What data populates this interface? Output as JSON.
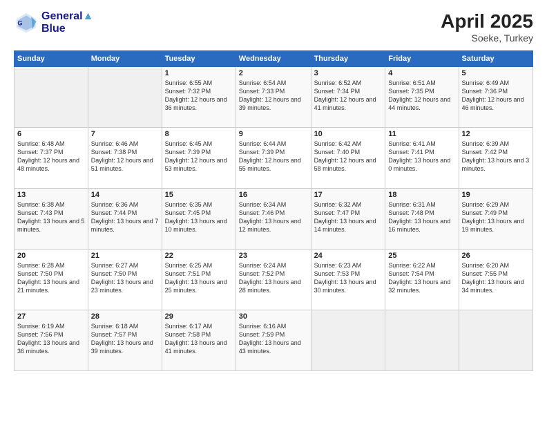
{
  "header": {
    "logo_line1": "General",
    "logo_line2": "Blue",
    "month": "April 2025",
    "location": "Soeke, Turkey"
  },
  "days_of_week": [
    "Sunday",
    "Monday",
    "Tuesday",
    "Wednesday",
    "Thursday",
    "Friday",
    "Saturday"
  ],
  "weeks": [
    [
      {
        "day": "",
        "info": ""
      },
      {
        "day": "",
        "info": ""
      },
      {
        "day": "1",
        "info": "Sunrise: 6:55 AM\nSunset: 7:32 PM\nDaylight: 12 hours and 36 minutes."
      },
      {
        "day": "2",
        "info": "Sunrise: 6:54 AM\nSunset: 7:33 PM\nDaylight: 12 hours and 39 minutes."
      },
      {
        "day": "3",
        "info": "Sunrise: 6:52 AM\nSunset: 7:34 PM\nDaylight: 12 hours and 41 minutes."
      },
      {
        "day": "4",
        "info": "Sunrise: 6:51 AM\nSunset: 7:35 PM\nDaylight: 12 hours and 44 minutes."
      },
      {
        "day": "5",
        "info": "Sunrise: 6:49 AM\nSunset: 7:36 PM\nDaylight: 12 hours and 46 minutes."
      }
    ],
    [
      {
        "day": "6",
        "info": "Sunrise: 6:48 AM\nSunset: 7:37 PM\nDaylight: 12 hours and 48 minutes."
      },
      {
        "day": "7",
        "info": "Sunrise: 6:46 AM\nSunset: 7:38 PM\nDaylight: 12 hours and 51 minutes."
      },
      {
        "day": "8",
        "info": "Sunrise: 6:45 AM\nSunset: 7:39 PM\nDaylight: 12 hours and 53 minutes."
      },
      {
        "day": "9",
        "info": "Sunrise: 6:44 AM\nSunset: 7:39 PM\nDaylight: 12 hours and 55 minutes."
      },
      {
        "day": "10",
        "info": "Sunrise: 6:42 AM\nSunset: 7:40 PM\nDaylight: 12 hours and 58 minutes."
      },
      {
        "day": "11",
        "info": "Sunrise: 6:41 AM\nSunset: 7:41 PM\nDaylight: 13 hours and 0 minutes."
      },
      {
        "day": "12",
        "info": "Sunrise: 6:39 AM\nSunset: 7:42 PM\nDaylight: 13 hours and 3 minutes."
      }
    ],
    [
      {
        "day": "13",
        "info": "Sunrise: 6:38 AM\nSunset: 7:43 PM\nDaylight: 13 hours and 5 minutes."
      },
      {
        "day": "14",
        "info": "Sunrise: 6:36 AM\nSunset: 7:44 PM\nDaylight: 13 hours and 7 minutes."
      },
      {
        "day": "15",
        "info": "Sunrise: 6:35 AM\nSunset: 7:45 PM\nDaylight: 13 hours and 10 minutes."
      },
      {
        "day": "16",
        "info": "Sunrise: 6:34 AM\nSunset: 7:46 PM\nDaylight: 13 hours and 12 minutes."
      },
      {
        "day": "17",
        "info": "Sunrise: 6:32 AM\nSunset: 7:47 PM\nDaylight: 13 hours and 14 minutes."
      },
      {
        "day": "18",
        "info": "Sunrise: 6:31 AM\nSunset: 7:48 PM\nDaylight: 13 hours and 16 minutes."
      },
      {
        "day": "19",
        "info": "Sunrise: 6:29 AM\nSunset: 7:49 PM\nDaylight: 13 hours and 19 minutes."
      }
    ],
    [
      {
        "day": "20",
        "info": "Sunrise: 6:28 AM\nSunset: 7:50 PM\nDaylight: 13 hours and 21 minutes."
      },
      {
        "day": "21",
        "info": "Sunrise: 6:27 AM\nSunset: 7:50 PM\nDaylight: 13 hours and 23 minutes."
      },
      {
        "day": "22",
        "info": "Sunrise: 6:25 AM\nSunset: 7:51 PM\nDaylight: 13 hours and 25 minutes."
      },
      {
        "day": "23",
        "info": "Sunrise: 6:24 AM\nSunset: 7:52 PM\nDaylight: 13 hours and 28 minutes."
      },
      {
        "day": "24",
        "info": "Sunrise: 6:23 AM\nSunset: 7:53 PM\nDaylight: 13 hours and 30 minutes."
      },
      {
        "day": "25",
        "info": "Sunrise: 6:22 AM\nSunset: 7:54 PM\nDaylight: 13 hours and 32 minutes."
      },
      {
        "day": "26",
        "info": "Sunrise: 6:20 AM\nSunset: 7:55 PM\nDaylight: 13 hours and 34 minutes."
      }
    ],
    [
      {
        "day": "27",
        "info": "Sunrise: 6:19 AM\nSunset: 7:56 PM\nDaylight: 13 hours and 36 minutes."
      },
      {
        "day": "28",
        "info": "Sunrise: 6:18 AM\nSunset: 7:57 PM\nDaylight: 13 hours and 39 minutes."
      },
      {
        "day": "29",
        "info": "Sunrise: 6:17 AM\nSunset: 7:58 PM\nDaylight: 13 hours and 41 minutes."
      },
      {
        "day": "30",
        "info": "Sunrise: 6:16 AM\nSunset: 7:59 PM\nDaylight: 13 hours and 43 minutes."
      },
      {
        "day": "",
        "info": ""
      },
      {
        "day": "",
        "info": ""
      },
      {
        "day": "",
        "info": ""
      }
    ]
  ]
}
